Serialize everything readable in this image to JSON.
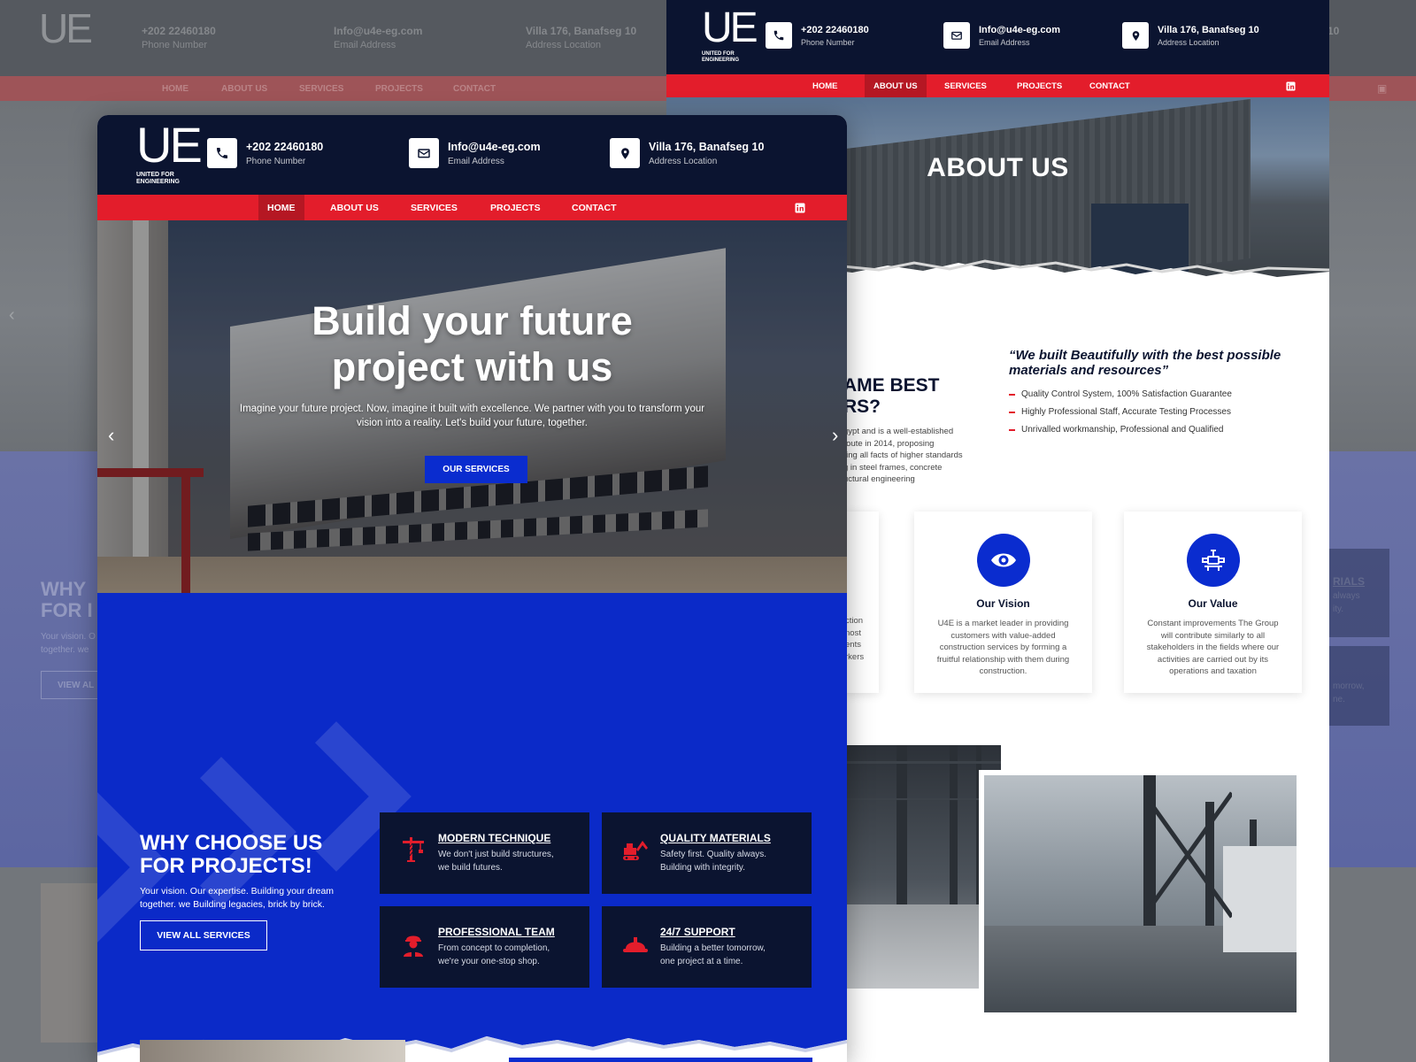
{
  "brand": {
    "logo_mark": "UE",
    "logo_line1": "UNITED FOR",
    "logo_line2": "ENGINEERING",
    "colors": {
      "navy": "#0b1430",
      "red": "#e31d2b",
      "blue": "#0a2ccf"
    }
  },
  "contacts": [
    {
      "value": "+202 22460180",
      "label": "Phone Number",
      "icon": "phone-icon"
    },
    {
      "value": "Info@u4e-eg.com",
      "label": "Email Address",
      "icon": "envelope-icon"
    },
    {
      "value": "Villa 176, Banafseg 10",
      "label": "Address Location",
      "icon": "location-pin-icon"
    }
  ],
  "nav": [
    "HOME",
    "ABOUT US",
    "SERVICES",
    "PROJECTS",
    "CONTACT"
  ],
  "social_icon": "linkedin-icon",
  "home": {
    "active_nav": "HOME",
    "hero": {
      "title_line1": "Build your future",
      "title_line2": "project with us",
      "subtitle_line1": "Imagine your future project. Now, imagine it built with excellence. We partner with you to transform your",
      "subtitle_line2": "vision into a reality. Let's build your future, together.",
      "button": "OUR SERVICES"
    },
    "why": {
      "title_line1": "WHY CHOOSE US",
      "title_line2": "FOR PROJECTS!",
      "subtitle_line1": "Your vision. Our expertise. Building your dream",
      "subtitle_line2": "together. we Building legacies, brick by brick.",
      "button": "VIEW ALL SERVICES"
    },
    "features": [
      {
        "title": "MODERN TECHNIQUE",
        "line1": "We don't just build structures,",
        "line2": "we build futures.",
        "icon": "crane-icon"
      },
      {
        "title": "QUALITY MATERIALS",
        "line1": "Safety first. Quality always.",
        "line2": "Building with integrity.",
        "icon": "excavator-icon"
      },
      {
        "title": "PROFESSIONAL TEAM",
        "line1": "From concept to completion,",
        "line2": "we're your one-stop shop.",
        "icon": "worker-icon"
      },
      {
        "title": "24/7 SUPPORT",
        "line1": "Building a better tomorrow,",
        "line2": "one project at a time.",
        "icon": "hard-hat-icon"
      }
    ]
  },
  "about": {
    "active_nav": "ABOUT US",
    "hero_title": "ABOUT US",
    "partial_heading_line1": "AME BEST",
    "partial_heading_line2": "RS?",
    "partial_para": [
      "gypt and is a well-established",
      "route in 2014, proposing",
      "ring all facts of higher standards",
      "g in steel frames, concrete",
      "uctural engineering"
    ],
    "quote_line1": "“We built Beautifully with the best possible",
    "quote_line2": "materials and resources”",
    "checks": [
      "Quality Control System, 100% Satisfaction Guarantee",
      "Highly Professional Staff, Accurate Testing Processes",
      "Unrivalled workmanship, Professional and Qualified"
    ],
    "partial_card_lines": [
      "ction",
      "nost",
      "ents",
      "rkers"
    ],
    "cards": [
      {
        "title": "Our Vision",
        "icon": "eye-icon",
        "lines": [
          "U4E is a market leader in providing",
          "customers with value-added",
          "construction services by forming a",
          "fruitful relationship with them during",
          "construction."
        ]
      },
      {
        "title": "Our Value",
        "icon": "pipe-valve-icon",
        "lines": [
          "Constant improvements The Group",
          "will contribute similarly to all",
          "stakeholders in the fields where our",
          "activities are carried out by its",
          "operations and taxation"
        ]
      }
    ]
  },
  "background": {
    "why_partial": [
      "WHY",
      "FOR I"
    ],
    "text_partial": [
      "Your vision. O",
      "together. we"
    ],
    "button_partial": "VIEW AL",
    "right_partial": [
      "RIALS",
      "always",
      "ity.",
      "morrow,",
      "ne."
    ]
  }
}
